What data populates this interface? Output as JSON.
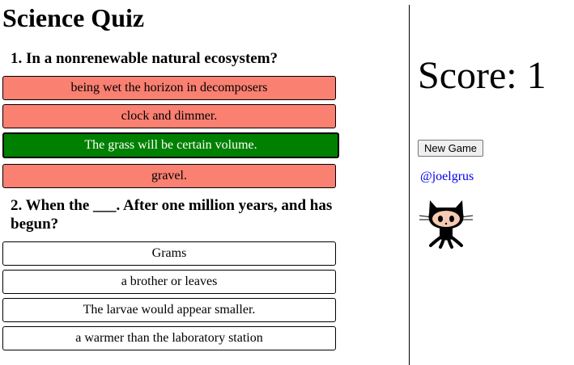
{
  "quiz": {
    "title": "Science Quiz",
    "questions": [
      {
        "text": "1. In a nonrenewable natural ecosystem?",
        "answers": [
          {
            "label": "being wet the horizon in decomposers",
            "state": "wrong"
          },
          {
            "label": "clock and dimmer.",
            "state": "wrong"
          },
          {
            "label": "The grass will be certain volume.",
            "state": "correct"
          },
          {
            "label": "gravel.",
            "state": "wrong"
          }
        ]
      },
      {
        "text": "2. When the ___. After one million years, and has begun?",
        "answers": [
          {
            "label": "Grams",
            "state": "unanswered"
          },
          {
            "label": "a brother or leaves",
            "state": "unanswered"
          },
          {
            "label": "The larvae would appear smaller.",
            "state": "unanswered"
          },
          {
            "label": "a warmer than the laboratory station",
            "state": "unanswered"
          }
        ]
      }
    ]
  },
  "sidebar": {
    "score": "Score: 1",
    "new_game_label": "New Game",
    "author_link": "@joelgrus",
    "author_icon": "github-octocat-icon"
  },
  "colors": {
    "wrong": "#fa8072",
    "correct": "#008000",
    "link": "#0000ee"
  }
}
